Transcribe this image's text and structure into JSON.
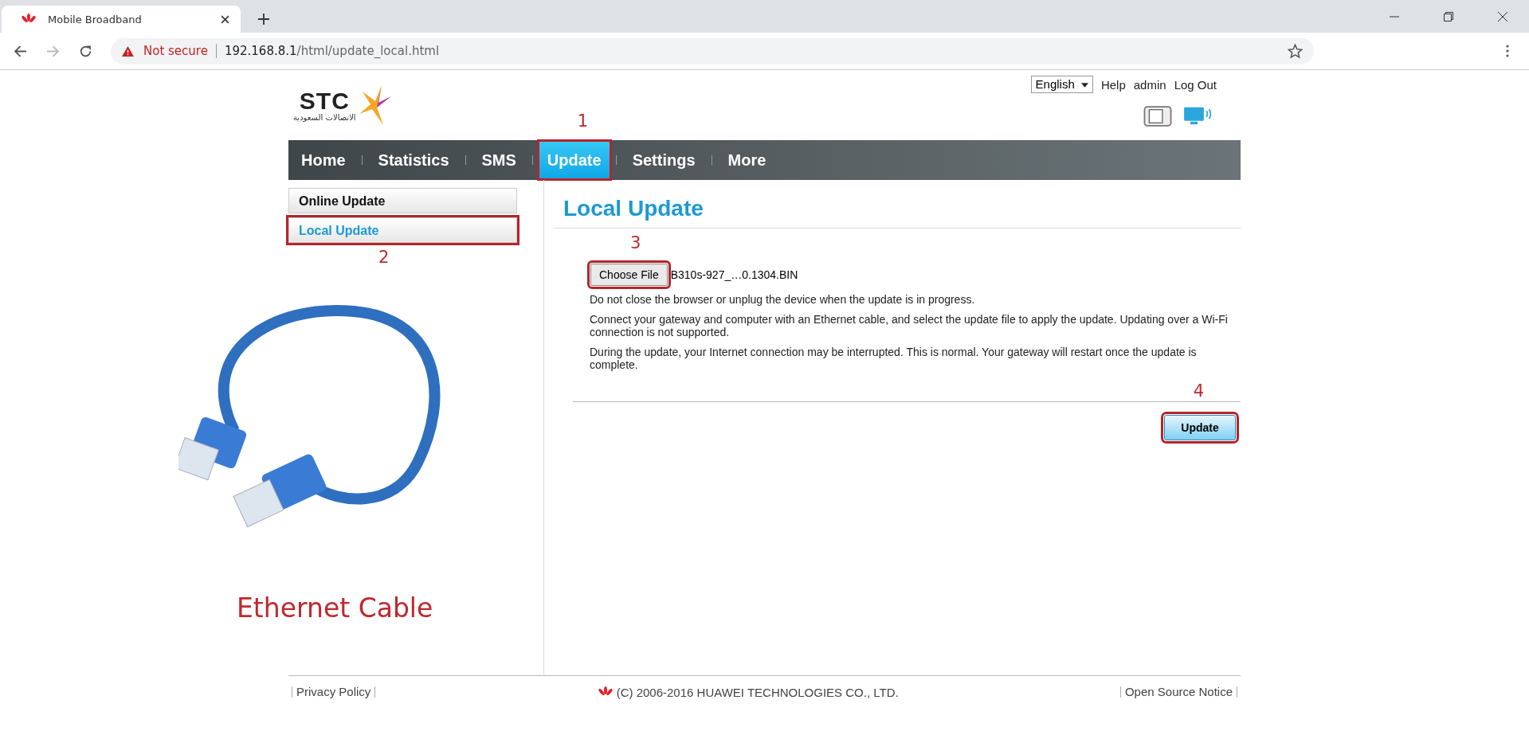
{
  "browser": {
    "tab_title": "Mobile Broadband",
    "security": "Not secure",
    "url_host": "192.168.8.1",
    "url_path": "/html/update_local.html"
  },
  "header": {
    "logo_text": "STC",
    "logo_subtext": "الاتصالات السعودية",
    "language": "English",
    "links": [
      "Help",
      "admin",
      "Log Out"
    ]
  },
  "nav": [
    {
      "label": "Home",
      "selected": false,
      "marked": false
    },
    {
      "label": "Statistics",
      "selected": false,
      "marked": false
    },
    {
      "label": "SMS",
      "selected": false,
      "marked": false
    },
    {
      "label": "Update",
      "selected": true,
      "marked": true,
      "callout": "1"
    },
    {
      "label": "Settings",
      "selected": false,
      "marked": false
    },
    {
      "label": "More",
      "selected": false,
      "marked": false
    }
  ],
  "sidebar": [
    {
      "label": "Online Update",
      "selected": false,
      "marked": false
    },
    {
      "label": "Local Update",
      "selected": true,
      "marked": true,
      "callout": "2"
    }
  ],
  "photo_caption": "Ethernet Cable",
  "content": {
    "title": "Local Update",
    "file": {
      "button": "Choose File",
      "marked": true,
      "callout": "3",
      "filename": "B310s-927_…0.1304.BIN"
    },
    "paragraphs": [
      "Do not close the browser or unplug the device when the update is in progress.",
      "Connect your gateway and computer with an Ethernet cable, and select the update file to apply the update. Updating over a Wi-Fi connection is not supported.",
      "During the update, your Internet connection may be interrupted. This is normal. Your gateway will restart once the update is complete."
    ],
    "update_button": {
      "label": "Update",
      "marked": true,
      "callout": "4"
    }
  },
  "footer": {
    "left": "Privacy Policy",
    "copyright": "(C) 2006-2016 HUAWEI TECHNOLOGIES CO., LTD.",
    "right": "Open Source Notice"
  }
}
